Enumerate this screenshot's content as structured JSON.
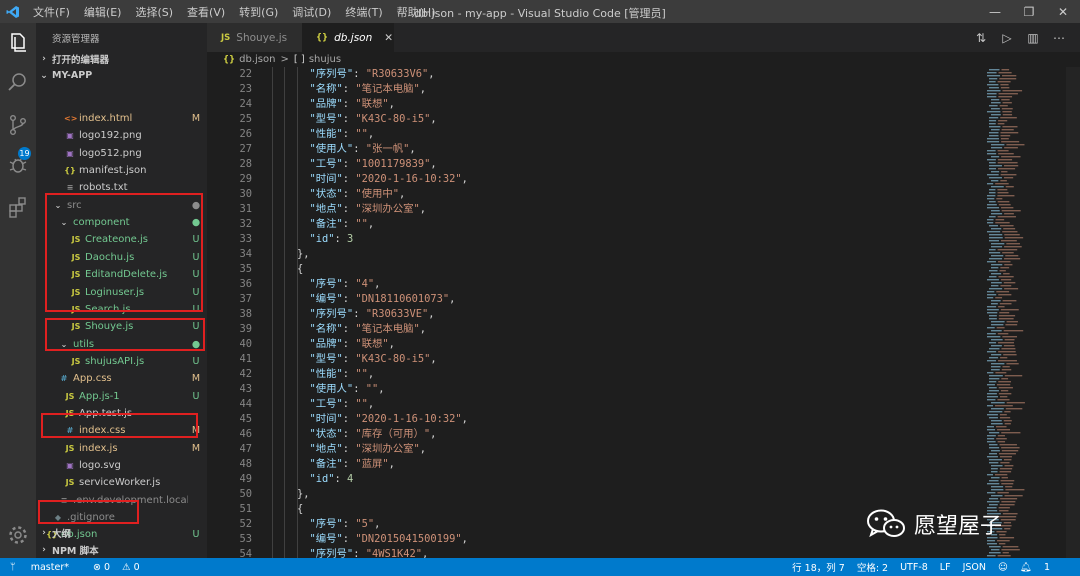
{
  "titlebar": {
    "menu": [
      "文件(F)",
      "编辑(E)",
      "选择(S)",
      "查看(V)",
      "转到(G)",
      "调试(D)",
      "终端(T)",
      "帮助(H)"
    ],
    "title": "db.json - my-app - Visual Studio Code [管理员]"
  },
  "activity": {
    "scm_badge": "19"
  },
  "sidebar": {
    "title": "资源管理器",
    "open_editors": "打开的编辑器",
    "project": "MY-APP",
    "outline": "大纲",
    "npm": "NPM 脚本",
    "files": [
      {
        "icon": "<>",
        "name": "index.html",
        "status": "M"
      },
      {
        "icon": "▣",
        "name": "logo192.png",
        "status": ""
      },
      {
        "icon": "▣",
        "name": "logo512.png",
        "status": ""
      },
      {
        "icon": "{}",
        "name": "manifest.json",
        "status": ""
      },
      {
        "icon": "≡",
        "name": "robots.txt",
        "status": ""
      },
      {
        "icon": "⌄",
        "name": "src",
        "status": "●"
      },
      {
        "icon": "⌄",
        "name": "component",
        "status": "●"
      },
      {
        "icon": "JS",
        "name": "Createone.js",
        "status": "U"
      },
      {
        "icon": "JS",
        "name": "Daochu.js",
        "status": "U"
      },
      {
        "icon": "JS",
        "name": "EditandDelete.js",
        "status": "U"
      },
      {
        "icon": "JS",
        "name": "Loginuser.js",
        "status": "U"
      },
      {
        "icon": "JS",
        "name": "Search.js",
        "status": "U"
      },
      {
        "icon": "JS",
        "name": "Shouye.js",
        "status": "U"
      },
      {
        "icon": "⌄",
        "name": "utils",
        "status": "●"
      },
      {
        "icon": "JS",
        "name": "shujusAPI.js",
        "status": "U"
      },
      {
        "icon": "#",
        "name": "App.css",
        "status": "M"
      },
      {
        "icon": "JS",
        "name": "App.js-1",
        "status": "U"
      },
      {
        "icon": "JS",
        "name": "App.test.js",
        "status": ""
      },
      {
        "icon": "#",
        "name": "index.css",
        "status": "M"
      },
      {
        "icon": "JS",
        "name": "index.js",
        "status": "M"
      },
      {
        "icon": "▣",
        "name": "logo.svg",
        "status": ""
      },
      {
        "icon": "JS",
        "name": "serviceWorker.js",
        "status": ""
      },
      {
        "icon": "≡",
        "name": ".env.development.local",
        "status": ""
      },
      {
        "icon": "◆",
        "name": ".gitignore",
        "status": ""
      },
      {
        "icon": "{}",
        "name": "db.json",
        "status": "U"
      }
    ]
  },
  "tabs": [
    {
      "icon": "JS",
      "label": "Shouye.js"
    },
    {
      "icon": "{}",
      "label": "db.json"
    }
  ],
  "breadcrumb": {
    "file": "db.json",
    "sep": ">",
    "node_icon": "[ ]",
    "node": "shujus"
  },
  "code_lines": [
    {
      "n": "22",
      "indent": 6,
      "key": "\"序列号\"",
      "val": "\"R30633V6\"",
      "type": "s",
      "tail": ","
    },
    {
      "n": "23",
      "indent": 6,
      "key": "\"名称\"",
      "val": "\"笔记本电脑\"",
      "type": "s",
      "tail": ","
    },
    {
      "n": "24",
      "indent": 6,
      "key": "\"品牌\"",
      "val": "\"联想\"",
      "type": "s",
      "tail": ","
    },
    {
      "n": "25",
      "indent": 6,
      "key": "\"型号\"",
      "val": "\"K43C-80-i5\"",
      "type": "s",
      "tail": ","
    },
    {
      "n": "26",
      "indent": 6,
      "key": "\"性能\"",
      "val": "\"\"",
      "type": "s",
      "tail": ","
    },
    {
      "n": "27",
      "indent": 6,
      "key": "\"使用人\"",
      "val": "\"张一帆\"",
      "type": "s",
      "tail": ","
    },
    {
      "n": "28",
      "indent": 6,
      "key": "\"工号\"",
      "val": "\"1001179839\"",
      "type": "s",
      "tail": ","
    },
    {
      "n": "29",
      "indent": 6,
      "key": "\"时间\"",
      "val": "\"2020-1-16-10:32\"",
      "type": "s",
      "tail": ","
    },
    {
      "n": "30",
      "indent": 6,
      "key": "\"状态\"",
      "val": "\"使用中\"",
      "type": "s",
      "tail": ","
    },
    {
      "n": "31",
      "indent": 6,
      "key": "\"地点\"",
      "val": "\"深圳办公室\"",
      "type": "s",
      "tail": ","
    },
    {
      "n": "32",
      "indent": 6,
      "key": "\"备注\"",
      "val": "\"\"",
      "type": "s",
      "tail": ","
    },
    {
      "n": "33",
      "indent": 6,
      "key": "\"id\"",
      "val": "3",
      "type": "n",
      "tail": ""
    },
    {
      "n": "34",
      "indent": 4,
      "text": "},"
    },
    {
      "n": "35",
      "indent": 4,
      "text": "{"
    },
    {
      "n": "36",
      "indent": 6,
      "key": "\"序号\"",
      "val": "\"4\"",
      "type": "s",
      "tail": ","
    },
    {
      "n": "37",
      "indent": 6,
      "key": "\"编号\"",
      "val": "\"DN18110601073\"",
      "type": "s",
      "tail": ","
    },
    {
      "n": "38",
      "indent": 6,
      "key": "\"序列号\"",
      "val": "\"R30633VE\"",
      "type": "s",
      "tail": ","
    },
    {
      "n": "39",
      "indent": 6,
      "key": "\"名称\"",
      "val": "\"笔记本电脑\"",
      "type": "s",
      "tail": ","
    },
    {
      "n": "40",
      "indent": 6,
      "key": "\"品牌\"",
      "val": "\"联想\"",
      "type": "s",
      "tail": ","
    },
    {
      "n": "41",
      "indent": 6,
      "key": "\"型号\"",
      "val": "\"K43C-80-i5\"",
      "type": "s",
      "tail": ","
    },
    {
      "n": "42",
      "indent": 6,
      "key": "\"性能\"",
      "val": "\"\"",
      "type": "s",
      "tail": ","
    },
    {
      "n": "43",
      "indent": 6,
      "key": "\"使用人\"",
      "val": "\"\"",
      "type": "s",
      "tail": ","
    },
    {
      "n": "44",
      "indent": 6,
      "key": "\"工号\"",
      "val": "\"\"",
      "type": "s",
      "tail": ","
    },
    {
      "n": "45",
      "indent": 6,
      "key": "\"时间\"",
      "val": "\"2020-1-16-10:32\"",
      "type": "s",
      "tail": ","
    },
    {
      "n": "46",
      "indent": 6,
      "key": "\"状态\"",
      "val": "\"库存（可用）\"",
      "type": "s",
      "tail": ","
    },
    {
      "n": "47",
      "indent": 6,
      "key": "\"地点\"",
      "val": "\"深圳办公室\"",
      "type": "s",
      "tail": ","
    },
    {
      "n": "48",
      "indent": 6,
      "key": "\"备注\"",
      "val": "\"蓝屏\"",
      "type": "s",
      "tail": ","
    },
    {
      "n": "49",
      "indent": 6,
      "key": "\"id\"",
      "val": "4",
      "type": "n",
      "tail": ""
    },
    {
      "n": "50",
      "indent": 4,
      "text": "},"
    },
    {
      "n": "51",
      "indent": 4,
      "text": "{"
    },
    {
      "n": "52",
      "indent": 6,
      "key": "\"序号\"",
      "val": "\"5\"",
      "type": "s",
      "tail": ","
    },
    {
      "n": "53",
      "indent": 6,
      "key": "\"编号\"",
      "val": "\"DN2015041500199\"",
      "type": "s",
      "tail": ","
    },
    {
      "n": "54",
      "indent": 6,
      "key": "\"序列号\"",
      "val": "\"4WS1K42\"",
      "type": "s",
      "tail": ","
    }
  ],
  "watermark": "愿望屋子",
  "statusbar": {
    "branch": "master*",
    "errors": "⊗ 0",
    "warnings": "⚠ 0",
    "position": "行 18，列 7",
    "spaces": "空格: 2",
    "encoding": "UTF-8",
    "eol": "LF",
    "language": "JSON",
    "bell": "1"
  },
  "colors": {
    "titlebar": "#3c3c3c",
    "activitybar": "#333333",
    "sidebar": "#252526",
    "editor": "#1e1e1e",
    "statusbar": "#007acc",
    "json_key": "#9cdcfe",
    "json_string": "#ce9178",
    "json_number": "#b5cea8",
    "git_untracked": "#73c991",
    "git_modified": "#e2c08d",
    "highlight_box": "#e02020"
  }
}
